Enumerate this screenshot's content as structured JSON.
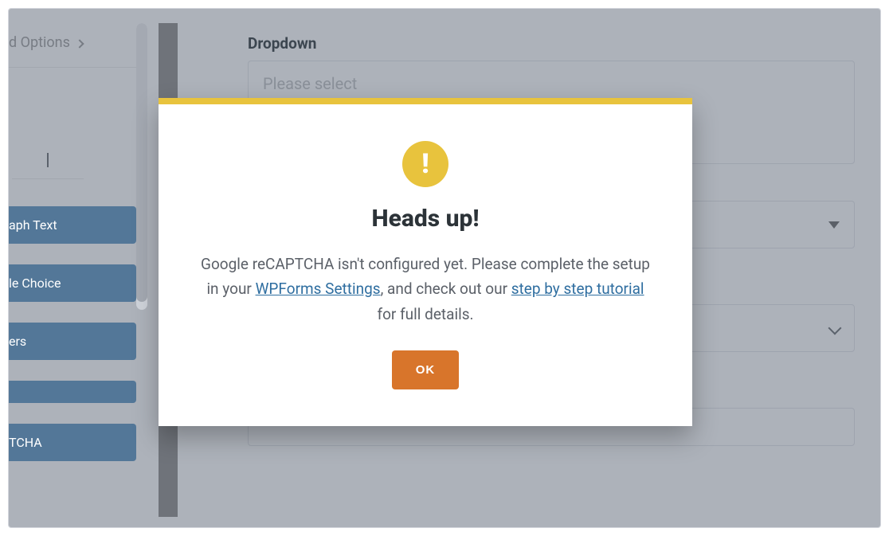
{
  "colors": {
    "accent_yellow": "#e8c33d",
    "accent_orange": "#d8752b",
    "link_blue": "#2f6ea0",
    "sidebar_item_bg": "#537798"
  },
  "sidebar": {
    "options_label": "d Options",
    "items": [
      {
        "label": "aph Text"
      },
      {
        "label": "le Choice"
      },
      {
        "label": "ers"
      },
      {
        "label": ""
      },
      {
        "label": "TCHA"
      }
    ]
  },
  "form": {
    "dropdown_label": "Dropdown",
    "dropdown_placeholder": "Please select"
  },
  "modal": {
    "title": "Heads up!",
    "text_before_link1": "Google reCAPTCHA isn't configured yet. Please complete the setup in your ",
    "link1": "WPForms Settings",
    "text_between": ", and check out our ",
    "link2": "step by step tutorial",
    "text_after": " for full details.",
    "ok_label": "OK",
    "warn_icon_name": "exclamation-icon"
  }
}
